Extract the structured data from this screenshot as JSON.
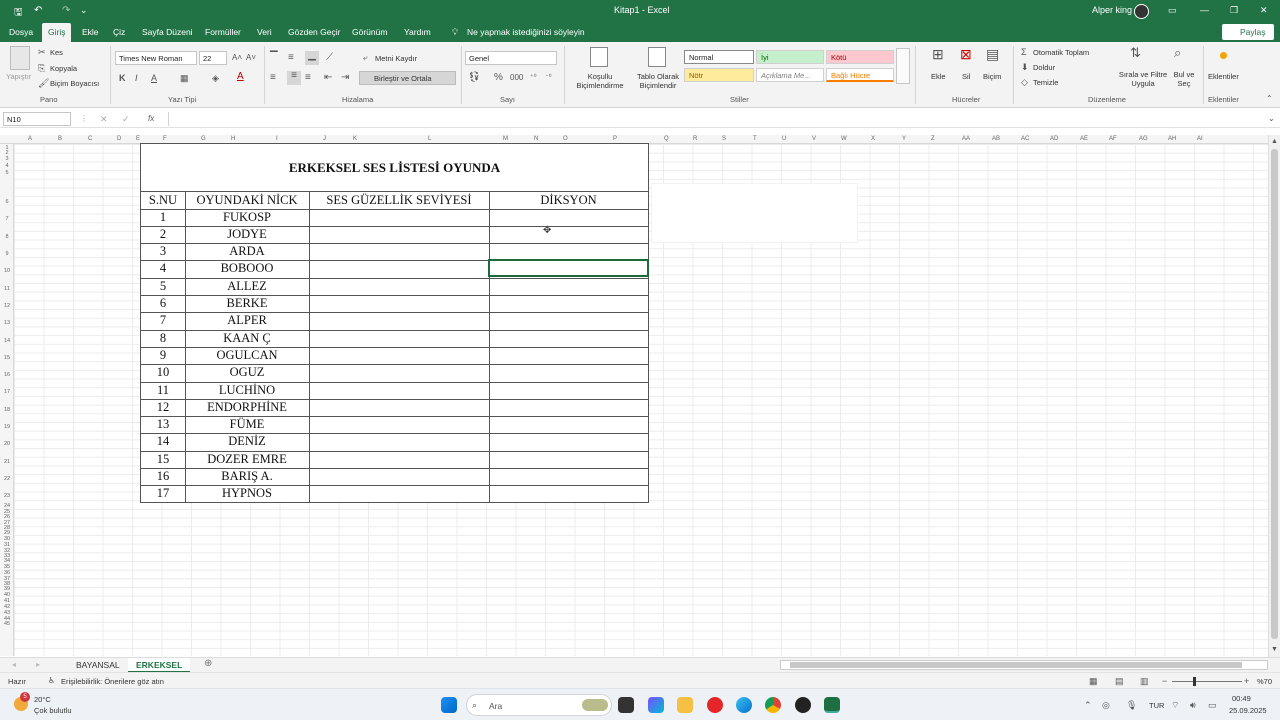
{
  "window": {
    "title": "Kitap1 - Excel",
    "user": "Alper king"
  },
  "menu": {
    "tabs": [
      "Dosya",
      "Giriş",
      "Ekle",
      "Çiz",
      "Sayfa Düzeni",
      "Formüller",
      "Veri",
      "Gözden Geçir",
      "Görünüm",
      "Yardım"
    ],
    "tell_me": "Ne yapmak istediğinizi söyleyin",
    "share": "Paylaş"
  },
  "ribbon": {
    "clipboard": {
      "paste": "Yapıştır",
      "cut": "Kes",
      "copy": "Kopyala",
      "format_painter": "Biçim Boyacısı",
      "group": "Pano"
    },
    "font": {
      "name": "Times New Roman",
      "size": "22",
      "group": "Yazı Tipi"
    },
    "alignment": {
      "wrap": "Metni Kaydır",
      "merge": "Birleştir ve Ortala",
      "group": "Hizalama"
    },
    "number": {
      "format": "Genel",
      "group": "Sayı"
    },
    "styles": {
      "conditional": "Koşullu Biçimlendirme",
      "table": "Tablo Olarak Biçimlendir",
      "normal": "Normal",
      "good": "İyi",
      "bad": "Kötü",
      "neutral": "Nötr",
      "explanatory": "Açıklama Me...",
      "linked": "Bağlı Hücre",
      "group": "Stiller"
    },
    "cells": {
      "insert": "Ekle",
      "delete": "Sil",
      "format": "Biçim",
      "group": "Hücreler"
    },
    "editing": {
      "autosum": "Otomatik Toplam",
      "fill": "Doldur",
      "clear": "Temizle",
      "sort": "Sırala ve Filtre Uygula",
      "find": "Bul ve Seç",
      "group": "Düzenleme"
    },
    "addins": {
      "label": "Eklentiler",
      "group": "Eklentiler"
    }
  },
  "formula_bar": {
    "name_box": "N10",
    "fx": "fx",
    "value": ""
  },
  "columns": [
    "A",
    "B",
    "C",
    "D",
    "E",
    "F",
    "G",
    "H",
    "I",
    "J",
    "K",
    "L",
    "M",
    "N",
    "O",
    "P",
    "Q",
    "R",
    "S",
    "T",
    "U",
    "V",
    "W",
    "X",
    "Y",
    "Z",
    "AA",
    "AB",
    "AC",
    "AD",
    "AE",
    "AF",
    "AG",
    "AH",
    "AI"
  ],
  "sheet": {
    "title": "ERKEKSEL SES LİSTESİ OYUNDA",
    "headers": [
      "S.NU",
      "OYUNDAKİ NİCK",
      "SES GÜZELLİK SEVİYESİ",
      "DİKSYON"
    ],
    "rows": [
      [
        "1",
        "FUKOSP"
      ],
      [
        "2",
        "JODYE"
      ],
      [
        "3",
        "ARDA"
      ],
      [
        "4",
        "BOBOOO"
      ],
      [
        "5",
        "ALLEZ"
      ],
      [
        "6",
        "BERKE"
      ],
      [
        "7",
        "ALPER"
      ],
      [
        "8",
        "KAAN Ç"
      ],
      [
        "9",
        "OGULCAN"
      ],
      [
        "10",
        "OGUZ"
      ],
      [
        "11",
        "LUCHİNO"
      ],
      [
        "12",
        "ENDORPHİNE"
      ],
      [
        "13",
        "FÜME"
      ],
      [
        "14",
        "DENİZ"
      ],
      [
        "15",
        "DOZER EMRE"
      ],
      [
        "16",
        "BARIŞ A."
      ],
      [
        "17",
        "HYPNOS"
      ]
    ]
  },
  "sheet_tabs": [
    "BAYANSAL",
    "ERKEKSEL"
  ],
  "status": {
    "ready": "Hazır",
    "accessibility": "Erişilebilirlik: Önerilere göz atın",
    "zoom": "%70"
  },
  "taskbar": {
    "weather_temp": "20°C",
    "weather_desc": "Çok bulutlu",
    "badge": "5",
    "search": "Ara",
    "lang": "TUR",
    "time": "00:49",
    "date": "25.09.2025"
  }
}
